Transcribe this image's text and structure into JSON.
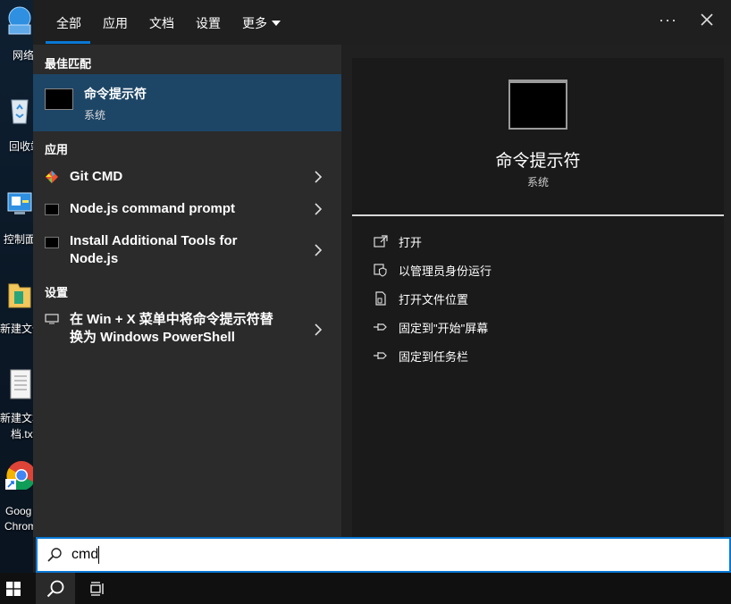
{
  "desktop": {
    "icons": [
      {
        "label": "网络",
        "icon": "network-icon"
      },
      {
        "label": "回收站",
        "icon": "recycle-bin-icon"
      },
      {
        "label": "控制面",
        "icon": "control-panel-icon"
      },
      {
        "label": "新建文件",
        "icon": "folder-icon"
      },
      {
        "label": "新建文本",
        "label2": "档.txt",
        "icon": "text-file-icon"
      },
      {
        "label": "Goog",
        "label2": "Chrom",
        "icon": "chrome-icon"
      }
    ]
  },
  "tabs": [
    {
      "label": "全部",
      "active": true
    },
    {
      "label": "应用"
    },
    {
      "label": "文档"
    },
    {
      "label": "设置"
    },
    {
      "label": "更多"
    }
  ],
  "top_actions": {
    "more_options": "···"
  },
  "sections": {
    "best_match": "最佳匹配",
    "apps": "应用",
    "settings": "设置"
  },
  "best_match": {
    "title": "命令提示符",
    "subtitle": "系统"
  },
  "apps": [
    {
      "name": "Git CMD",
      "icon": "git-icon"
    },
    {
      "name": "Node.js command prompt",
      "icon": "console-icon"
    },
    {
      "name_line1": "Install Additional Tools for",
      "name_line2": "Node.js",
      "icon": "console-icon"
    }
  ],
  "settings_items": [
    {
      "name_line1": "在 Win + X 菜单中将命令提示符替",
      "name_line2": "换为 Windows PowerShell",
      "icon": "monitor-icon"
    }
  ],
  "detail": {
    "title": "命令提示符",
    "subtitle": "系统",
    "actions": [
      {
        "label": "打开",
        "icon": "open-icon"
      },
      {
        "label": "以管理员身份运行",
        "icon": "shield-icon"
      },
      {
        "label": "打开文件位置",
        "icon": "file-location-icon"
      },
      {
        "label": "固定到\"开始\"屏幕",
        "icon": "pin-icon"
      },
      {
        "label": "固定到任务栏",
        "icon": "pin-icon"
      }
    ]
  },
  "search": {
    "query": "cmd"
  },
  "colors": {
    "accent": "#0a78d4",
    "selected_bg": "#1d4566",
    "panel_bg": "#2b2b2b"
  }
}
